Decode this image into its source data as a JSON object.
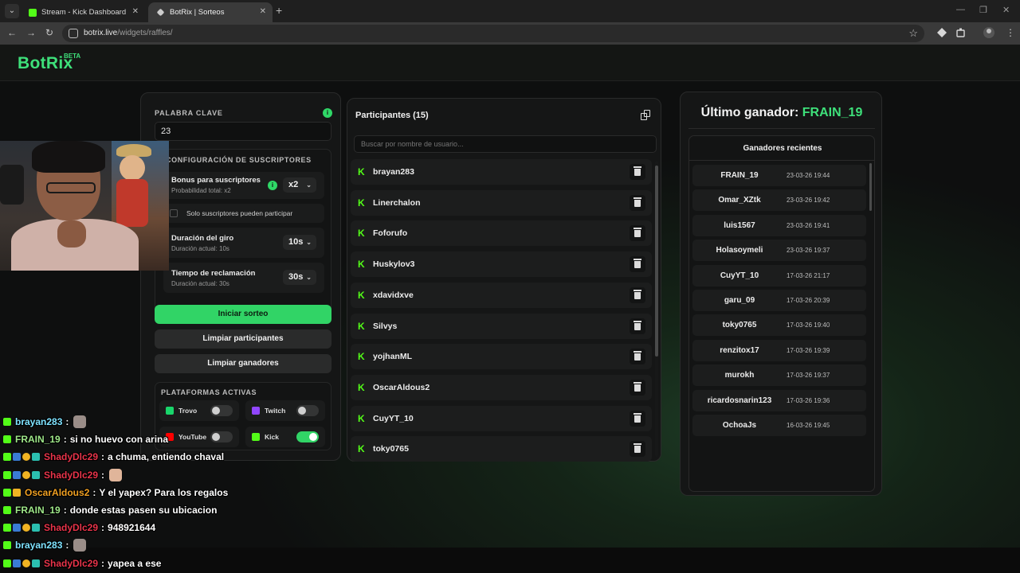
{
  "browser": {
    "tabs": [
      {
        "label": "Stream - Kick Dashboard",
        "active": false
      },
      {
        "label": "BotRix | Sorteos",
        "active": true
      }
    ],
    "url_domain": "botrix.live",
    "url_path": "/widgets/raffles/"
  },
  "app": {
    "logo": "BotRix",
    "beta": "BETA",
    "accent_color": "#31d466"
  },
  "left_panel": {
    "keyword_label": "PALABRA CLAVE",
    "keyword_value": "23",
    "info_icon": "i",
    "subs_title": "CONFIGURACIÓN DE SUSCRIPTORES",
    "bonus_title": "Bonus para suscriptores",
    "bonus_sub": "Probabilidad total: x2",
    "bonus_value": "x2",
    "subs_only_label": "Solo suscriptores pueden participar",
    "spin_title": "Duración del giro",
    "spin_sub": "Duración actual: 10s",
    "spin_value": "10s",
    "claim_title": "Tiempo de reclamación",
    "claim_sub": "Duración actual: 30s",
    "claim_value": "30s",
    "start_button": "Iniciar sorteo",
    "clear_participants_button": "Limpiar participantes",
    "clear_winners_button": "Limpiar ganadores",
    "platforms_title": "PLATAFORMAS ACTIVAS",
    "platforms": [
      {
        "name": "Trovo",
        "enabled": false,
        "color": "#19d66b"
      },
      {
        "name": "Twitch",
        "enabled": false,
        "color": "#9146ff"
      },
      {
        "name": "YouTube",
        "enabled": false,
        "color": "#ff0000"
      },
      {
        "name": "Kick",
        "enabled": true,
        "color": "#53fc18"
      }
    ]
  },
  "participants": {
    "title": "Participantes (15)",
    "search_placeholder": "Buscar por nombre de usuario...",
    "items": [
      "brayan283",
      "Linerchalon",
      "Foforufo",
      "Huskylov3",
      "xdavidxve",
      "Silvys",
      "yojhanML",
      "OscarAldous2",
      "CuyYT_10",
      "toky0765"
    ]
  },
  "winners": {
    "last_label": "Último ganador:",
    "last_name": "FRAIN_19",
    "recent_title": "Ganadores recientes",
    "items": [
      {
        "name": "FRAIN_19",
        "date": "23-03-26 19:44"
      },
      {
        "name": "Omar_XZtk",
        "date": "23-03-26 19:42"
      },
      {
        "name": "luis1567",
        "date": "23-03-26 19:41"
      },
      {
        "name": "Holasoymeli",
        "date": "23-03-26 19:37"
      },
      {
        "name": "CuyYT_10",
        "date": "17-03-26 21:17"
      },
      {
        "name": "garu_09",
        "date": "17-03-26 20:39"
      },
      {
        "name": "toky0765",
        "date": "17-03-26 19:40"
      },
      {
        "name": "renzitox17",
        "date": "17-03-26 19:39"
      },
      {
        "name": "murokh",
        "date": "17-03-26 19:37"
      },
      {
        "name": "ricardosnarin123",
        "date": "17-03-26 19:36"
      },
      {
        "name": "OchoaJs",
        "date": "16-03-26 19:45"
      }
    ]
  },
  "chat": [
    {
      "user": "brayan283",
      "sep": ":",
      "text": "",
      "color": "#7fe3ff",
      "badges": [
        "k"
      ],
      "emote": "cat"
    },
    {
      "user": "FRAIN_19",
      "sep": ":",
      "text": "si no huevo con arina",
      "color": "#9fe88a",
      "badges": [
        "k"
      ]
    },
    {
      "user": "ShadyDlc29",
      "sep": ":",
      "text": "a chuma, entiendo chaval",
      "color": "#e8344a",
      "badges": [
        "k",
        "blue",
        "gold",
        "cyan"
      ]
    },
    {
      "user": "ShadyDlc29",
      "sep": ":",
      "text": "",
      "color": "#e8344a",
      "badges": [
        "k",
        "blue",
        "gold",
        "cyan"
      ],
      "emote": "hand"
    },
    {
      "user": "OscarAldous2",
      "sep": ":",
      "text": "Y el yapex? Para los regalos",
      "color": "#f0a022",
      "badges": [
        "k",
        "crown"
      ]
    },
    {
      "user": "FRAIN_19",
      "sep": ":",
      "text": "donde estas pasen su ubicacion",
      "color": "#9fe88a",
      "badges": [
        "k"
      ]
    },
    {
      "user": "ShadyDlc29",
      "sep": ":",
      "text": "948921644",
      "color": "#e8344a",
      "badges": [
        "k",
        "blue",
        "gold",
        "cyan"
      ]
    },
    {
      "user": "brayan283",
      "sep": ":",
      "text": "",
      "color": "#7fe3ff",
      "badges": [
        "k"
      ],
      "emote": "cat"
    },
    {
      "user": "ShadyDlc29",
      "sep": ":",
      "text": "yapea a ese",
      "color": "#e8344a",
      "badges": [
        "k",
        "blue",
        "gold",
        "cyan"
      ]
    }
  ]
}
